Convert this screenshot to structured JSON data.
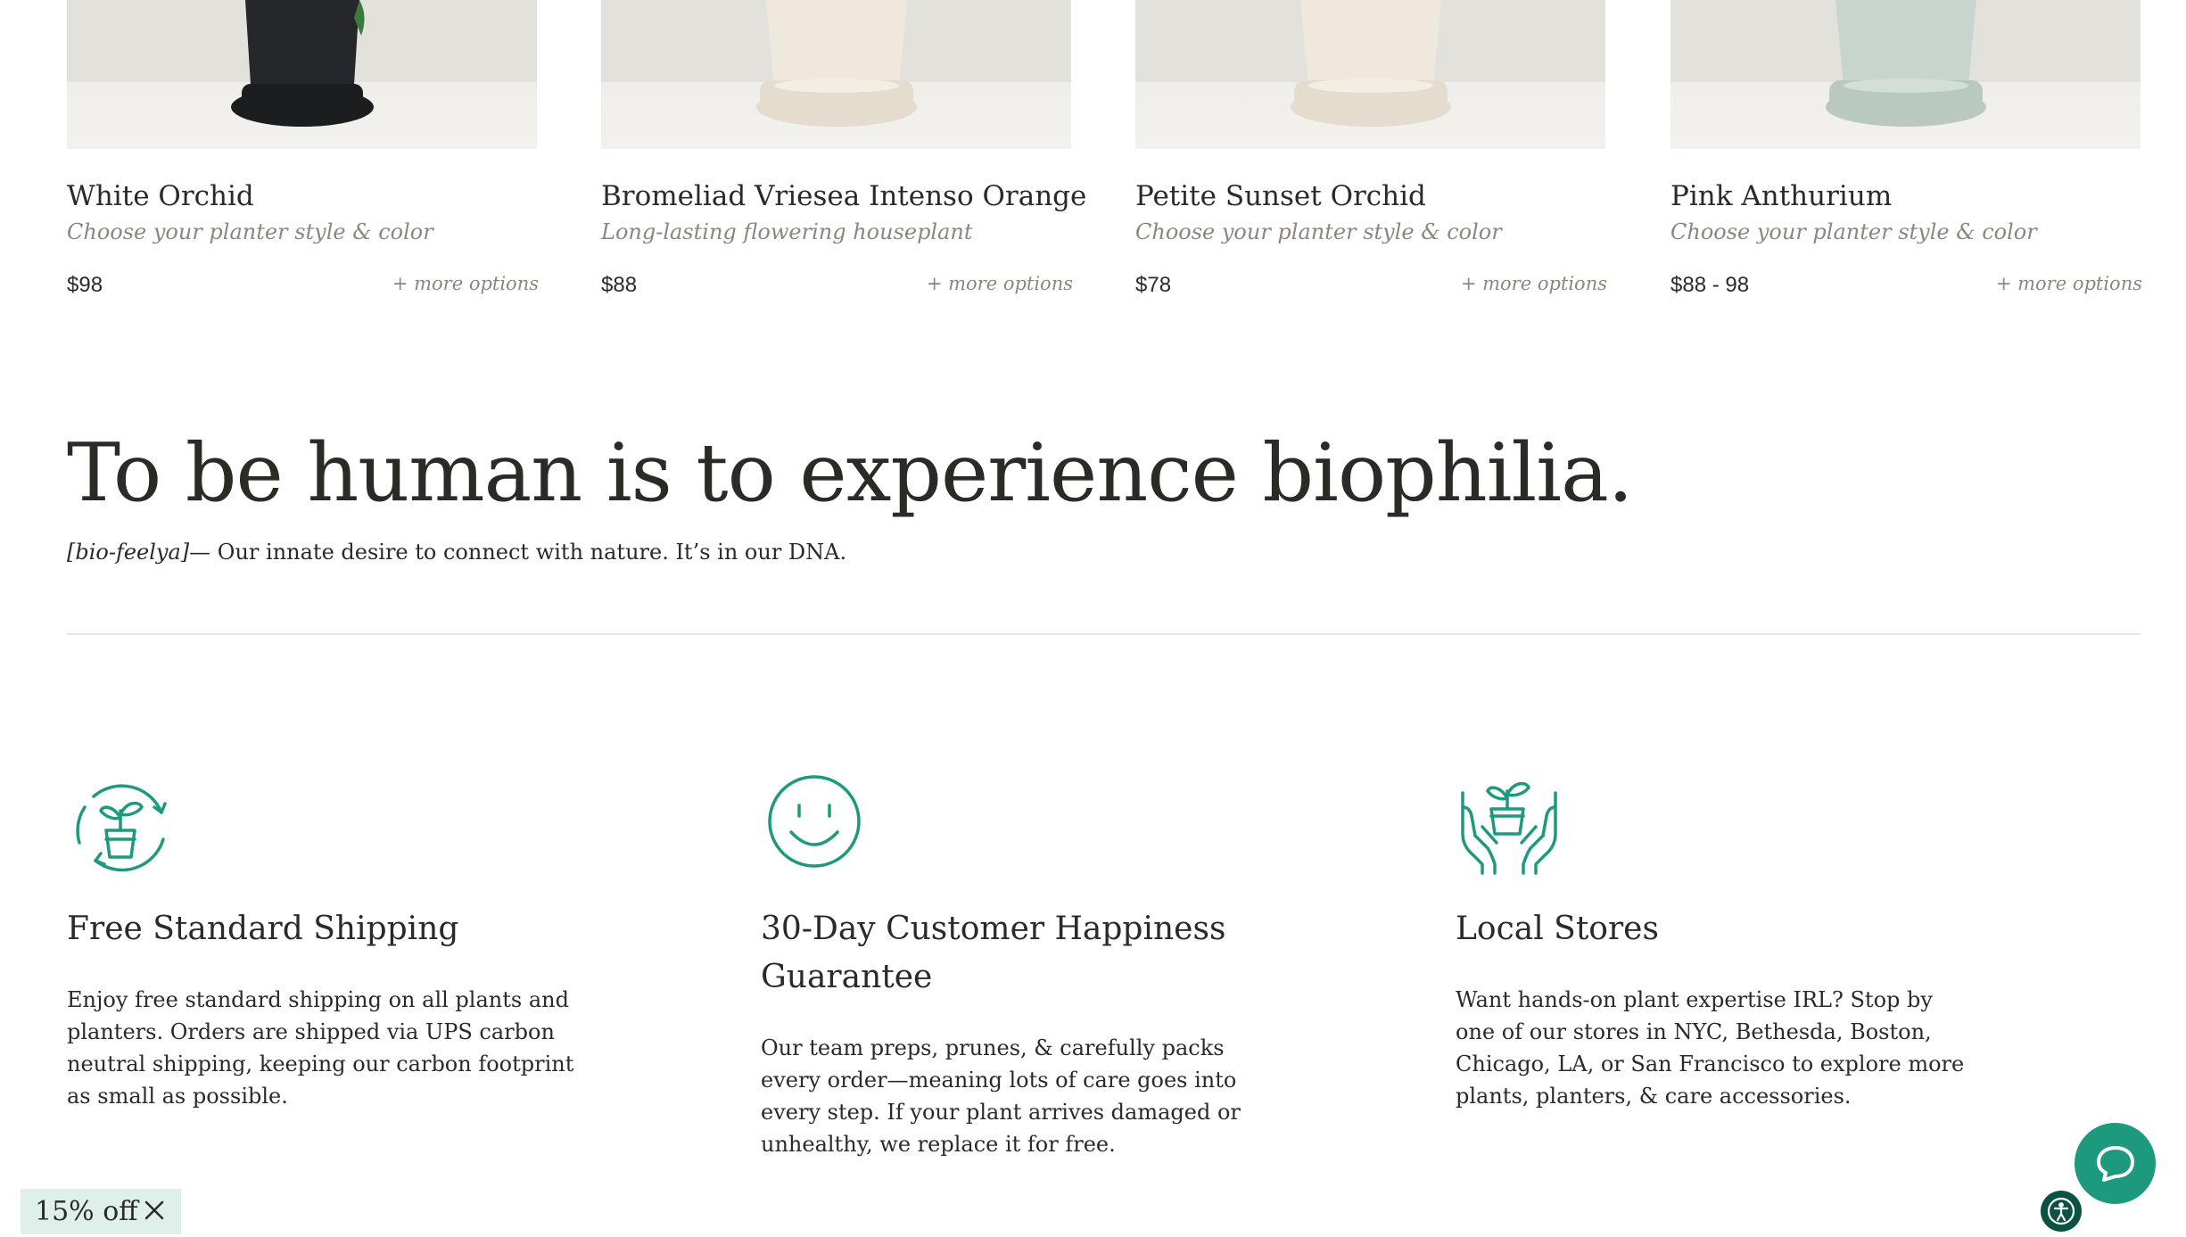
{
  "products": [
    {
      "name": "White Orchid",
      "subtitle": "Choose your planter style & color",
      "price": "$98",
      "more": "+ more options",
      "pot_color": "#26272a",
      "saucer_color": "#1c1d1f"
    },
    {
      "name": "Bromeliad Vriesea Intenso Orange",
      "subtitle": "Long-lasting flowering houseplant",
      "price": "$88",
      "more": "+ more options",
      "pot_color": "#efe9dd",
      "saucer_color": "#e4dccc"
    },
    {
      "name": "Petite Sunset Orchid",
      "subtitle": "Choose your planter style & color",
      "price": "$78",
      "more": "+ more options",
      "pot_color": "#efe9dd",
      "saucer_color": "#e4dccc"
    },
    {
      "name": "Pink Anthurium",
      "subtitle": "Choose your planter style & color",
      "price": "$88 - 98",
      "more": "+ more options",
      "pot_color": "#c8d5cf",
      "saucer_color": "#b9c9c2"
    }
  ],
  "biophilia": {
    "title": "To be human is to experience biophilia.",
    "pronunciation": "[bio-feelya]",
    "description": "— Our innate desire to connect with nature. It’s in our DNA."
  },
  "features": [
    {
      "icon": "recycle-plant-icon",
      "title": "Free Standard Shipping",
      "body": "Enjoy free standard shipping on all plants and planters. Orders are shipped via UPS carbon neutral shipping, keeping our carbon footprint as small as possible."
    },
    {
      "icon": "smiley-face-icon",
      "title": "30-Day Customer Happiness Guarantee",
      "body": "Our team preps, prunes, & carefully packs every order—meaning lots of care goes into every step. If your plant arrives damaged or unhealthy, we replace it for free."
    },
    {
      "icon": "hands-plant-icon",
      "title": "Local Stores",
      "body": "Want hands-on plant expertise IRL? Stop by one of our stores in NYC, Bethesda, Boston, Chicago, LA, or San Francisco to explore more plants, planters, & care accessories."
    }
  ],
  "promo": {
    "label": "15% off"
  },
  "colors": {
    "accent": "#1d9a7e",
    "text": "#2b2a26",
    "muted": "#8b877f",
    "promo_bg": "#dff0ea",
    "a11y_bg": "#0c5243"
  }
}
